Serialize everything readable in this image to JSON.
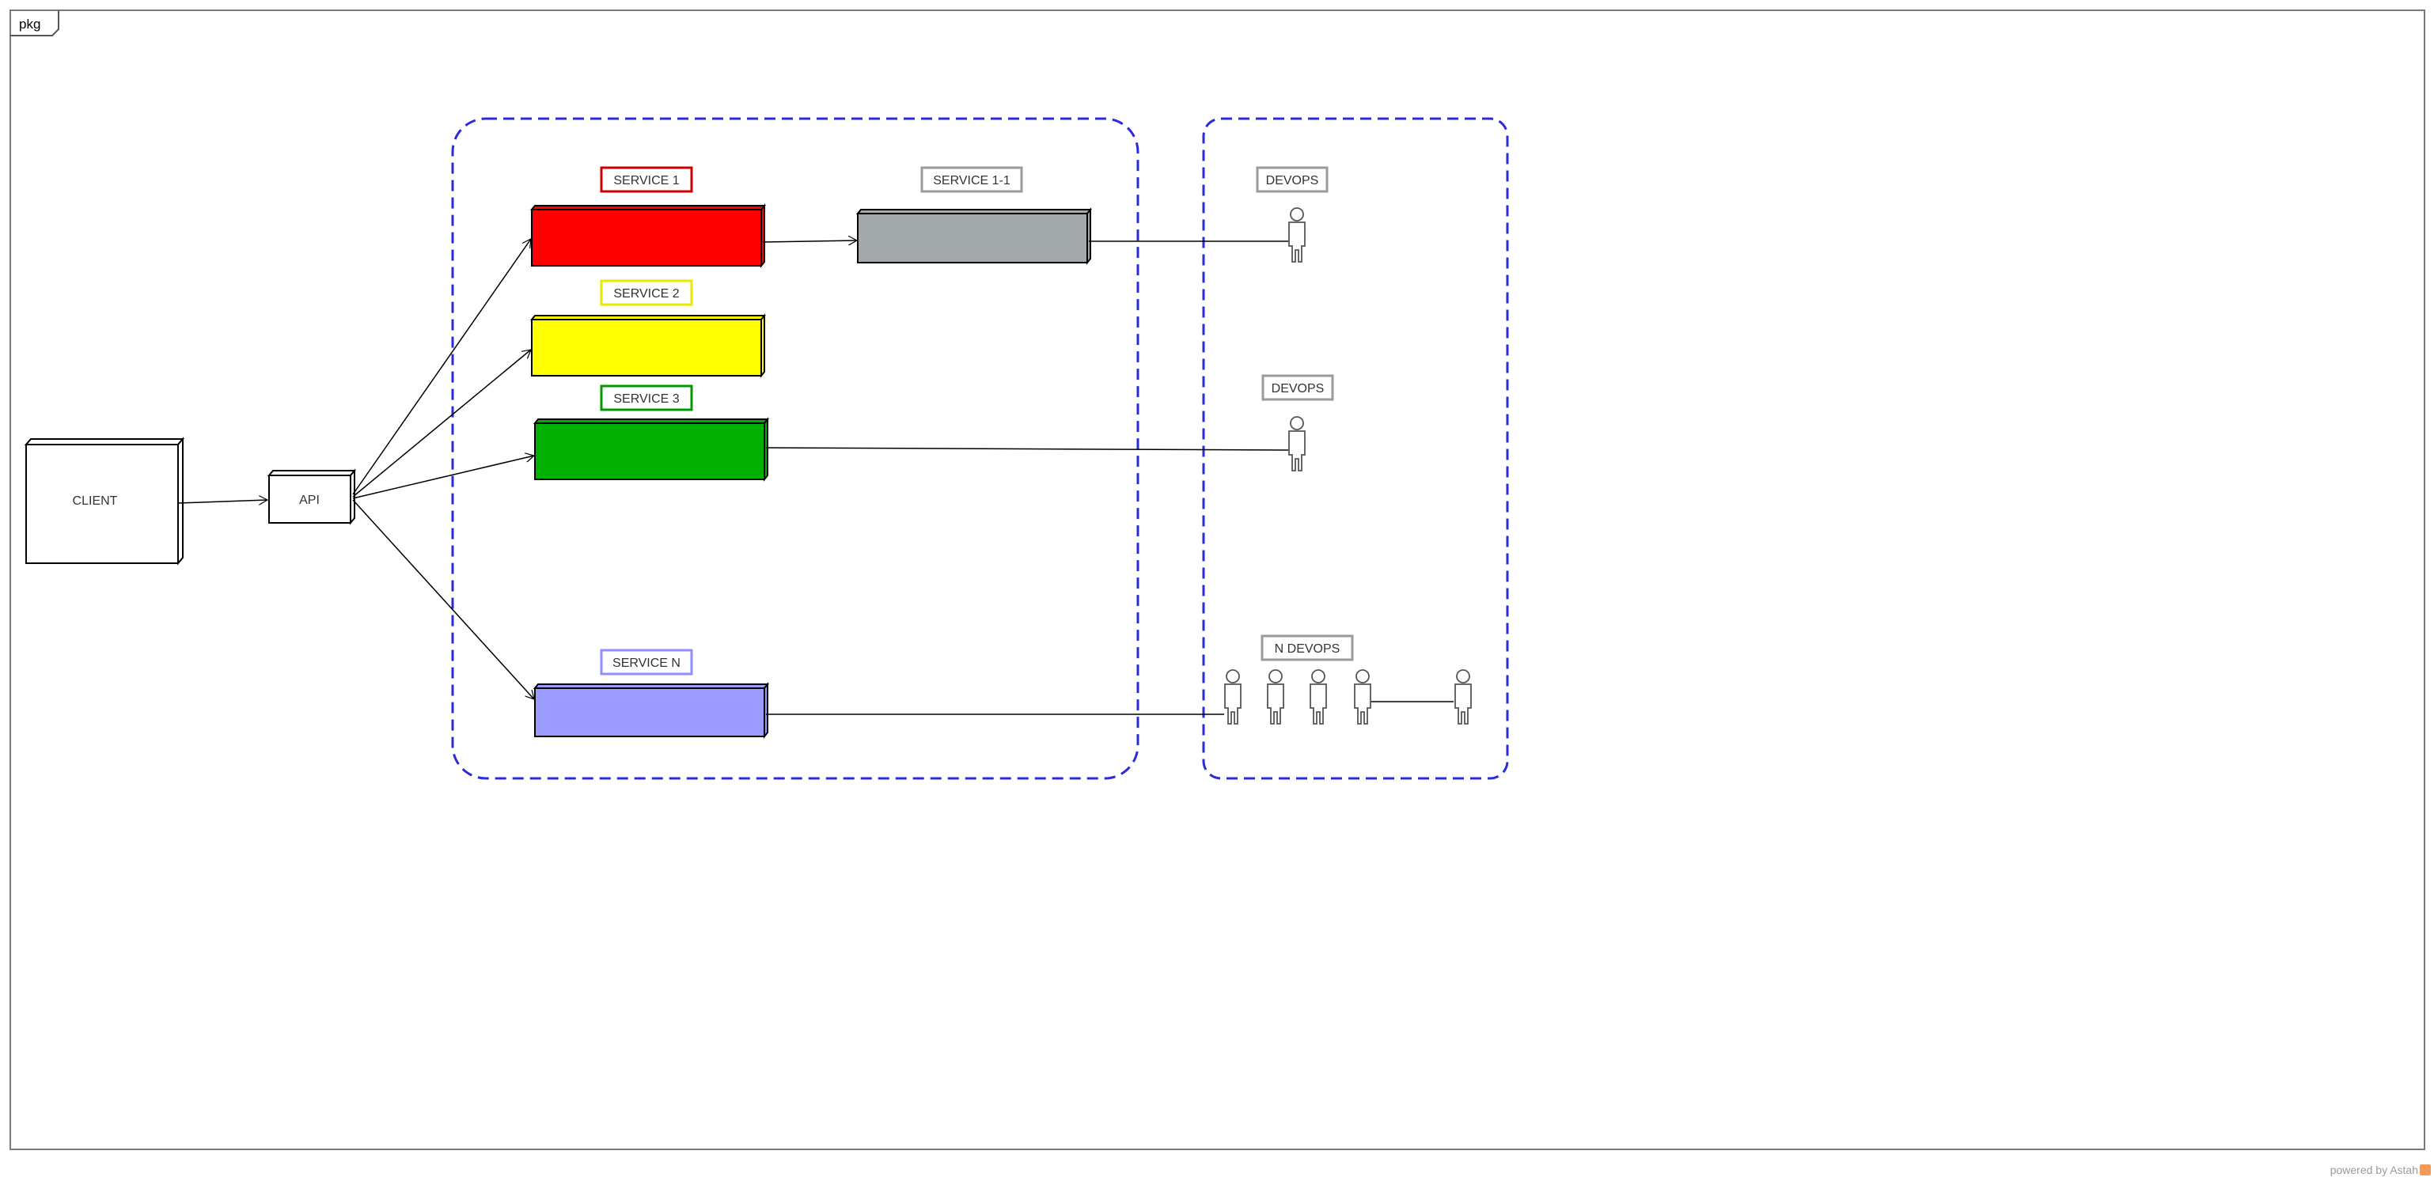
{
  "frame": {
    "label": "pkg"
  },
  "nodes": {
    "client": {
      "label": "CLIENT"
    },
    "api": {
      "label": "API"
    }
  },
  "services": [
    {
      "label": "SERVICE 1",
      "color": "#ff0000",
      "border": "#cc0000"
    },
    {
      "label": "SERVICE 2",
      "color": "#ffff00",
      "border": "#e8e800"
    },
    {
      "label": "SERVICE 3",
      "color": "#00b000",
      "border": "#009900"
    },
    {
      "label": "SERVICE N",
      "color": "#9b9bff",
      "border": "#8f8fff"
    },
    {
      "label": "SERVICE 1-1",
      "color": "#a3a8aa",
      "border": "#9a9a9a"
    }
  ],
  "devops": [
    {
      "label": "DEVOPS"
    },
    {
      "label": "DEVOPS"
    },
    {
      "label": "N DEVOPS"
    }
  ],
  "colors": {
    "group_border": "#2b2bd8",
    "line": "#000000"
  },
  "footer": {
    "text": "powered by Astah"
  }
}
